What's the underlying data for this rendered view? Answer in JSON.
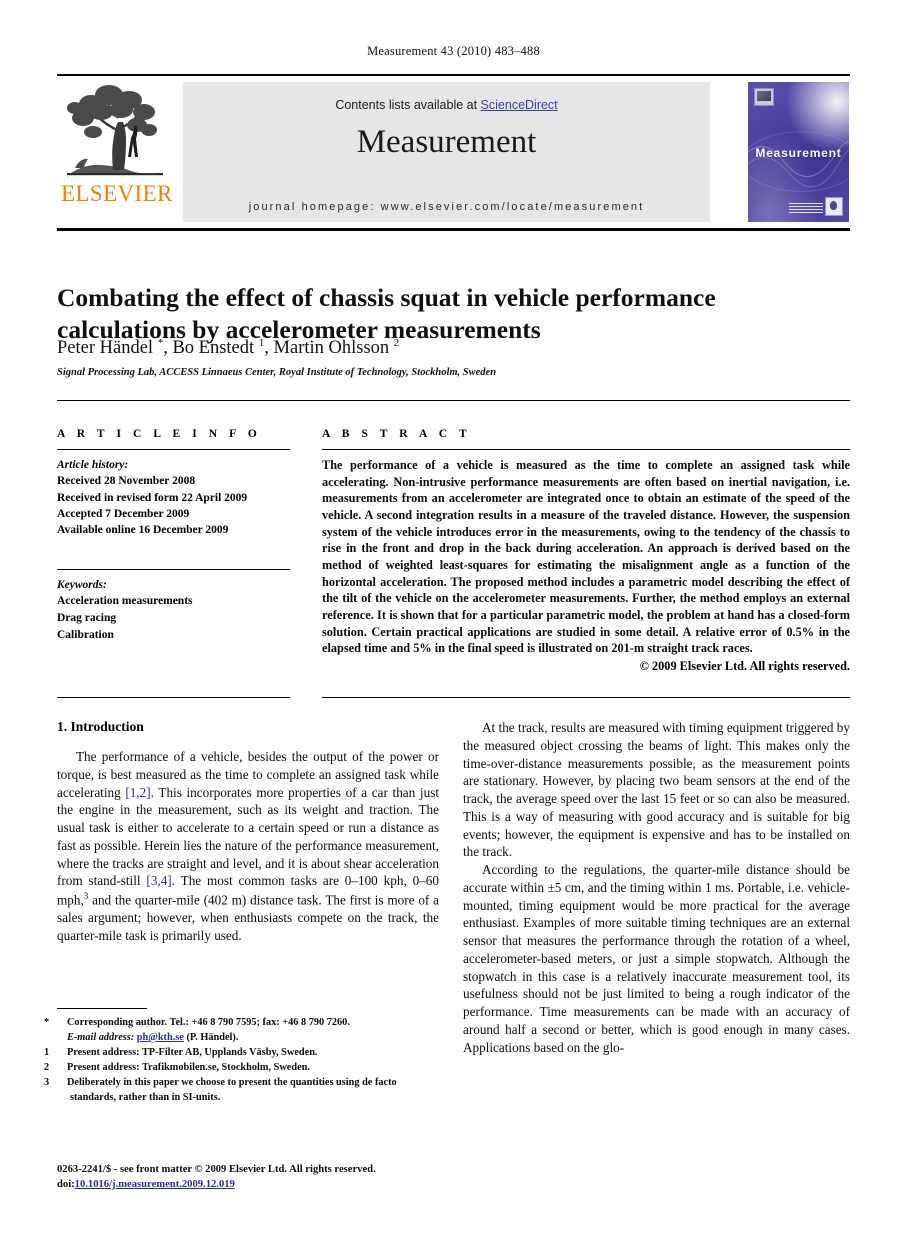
{
  "running_head": "Measurement 43 (2010) 483–488",
  "masthead": {
    "contents_prefix": "Contents lists available at ",
    "sciencedirect": "ScienceDirect",
    "journal_name": "Measurement",
    "homepage": "journal homepage: www.elsevier.com/locate/measurement",
    "publisher_wordmark": "ELSEVIER",
    "cover_title": "Measurement",
    "colors": {
      "elsevier_orange": "#F08000",
      "link_blue": "#3b3bae",
      "band_grey": "#e6e6e6",
      "cover_purple": "#4a3f9e"
    }
  },
  "article": {
    "title": "Combating the effect of chassis squat in vehicle performance calculations by accelerometer measurements",
    "authors_html": "Peter Händel <sup>*</sup>, Bo Enstedt <sup>1</sup>, Martin Ohlsson <sup>2</sup>",
    "affiliation": "Signal Processing Lab, ACCESS Linnaeus Center, Royal Institute of Technology, Stockholm, Sweden"
  },
  "info": {
    "heading": "A R T I C L E   I N F O",
    "history_label": "Article history:",
    "history": [
      "Received 28 November 2008",
      "Received in revised form 22 April 2009",
      "Accepted 7 December 2009",
      "Available online 16 December 2009"
    ],
    "keywords_label": "Keywords:",
    "keywords": [
      "Acceleration measurements",
      "Drag racing",
      "Calibration"
    ]
  },
  "abstract": {
    "heading": "A B S T R A C T",
    "text": "The performance of a vehicle is measured as the time to complete an assigned task while accelerating. Non-intrusive performance measurements are often based on inertial navigation, i.e. measurements from an accelerometer are integrated once to obtain an estimate of the speed of the vehicle. A second integration results in a measure of the traveled distance. However, the suspension system of the vehicle introduces error in the measurements, owing to the tendency of the chassis to rise in the front and drop in the back during acceleration. An approach is derived based on the method of weighted least-squares for estimating the misalignment angle as a function of the horizontal acceleration. The proposed method includes a parametric model describing the effect of the tilt of the vehicle on the accelerometer measurements. Further, the method employs an external reference. It is shown that for a particular parametric model, the problem at hand has a closed-form solution. Certain practical applications are studied in some detail. A relative error of 0.5% in the elapsed time and 5% in the final speed is illustrated on 201-m straight track races.",
    "copyright": "© 2009 Elsevier Ltd. All rights reserved."
  },
  "body": {
    "section_number_title": "1. Introduction",
    "left_paragraphs": [
      "The performance of a vehicle, besides the output of the power or torque, is best measured as the time to complete an assigned task while accelerating [1,2]. This incorporates more properties of a car than just the engine in the measurement, such as its weight and traction. The usual task is either to accelerate to a certain speed or run a distance as fast as possible. Herein lies the nature of the performance measurement, where the tracks are straight and level, and it is about shear acceleration from stand-still [3,4]. The most common tasks are 0–100 kph, 0–60 mph,3 and the quarter-mile (402 m) distance task. The first is more of a sales argument; however, when enthusiasts compete on the track, the quarter-mile task is primarily used."
    ],
    "right_paragraphs": [
      "At the track, results are measured with timing equipment triggered by the measured object crossing the beams of light. This makes only the time-over-distance measurements possible, as the measurement points are stationary. However, by placing two beam sensors at the end of the track, the average speed over the last 15 feet or so can also be measured. This is a way of measuring with good accuracy and is suitable for big events; however, the equipment is expensive and has to be installed on the track.",
      "According to the regulations, the quarter-mile distance should be accurate within ±5 cm, and the timing within 1 ms. Portable, i.e. vehicle-mounted, timing equipment would be more practical for the average enthusiast. Examples of more suitable timing techniques are an external sensor that measures the performance through the rotation of a wheel, accelerometer-based meters, or just a simple stopwatch. Although the stopwatch in this case is a relatively inaccurate measurement tool, its usefulness should not be just limited to being a rough indicator of the performance. Time measurements can be made with an accuracy of around half a second or better, which is good enough in many cases. Applications based on the glo-"
    ]
  },
  "footnotes": [
    {
      "mark": "*",
      "text": "Corresponding author. Tel.: +46 8 790 7595; fax: +46 8 790 7260."
    },
    {
      "mark": "",
      "label": "E-mail address:",
      "link": "ph@kth.se",
      "suffix": "(P. Händel)."
    },
    {
      "mark": "1",
      "text": "Present address: TP-Filter AB, Upplands Väsby, Sweden."
    },
    {
      "mark": "2",
      "text": "Present address: Trafikmobilen.se, Stockholm, Sweden."
    },
    {
      "mark": "3",
      "text": "Deliberately in this paper we choose to present the quantities using de facto standards, rather than in SI-units."
    }
  ],
  "imprint": {
    "issn_line": "0263-2241/$ - see front matter © 2009 Elsevier Ltd. All rights reserved.",
    "doi_label": "doi:",
    "doi": "10.1016/j.measurement.2009.12.019"
  }
}
